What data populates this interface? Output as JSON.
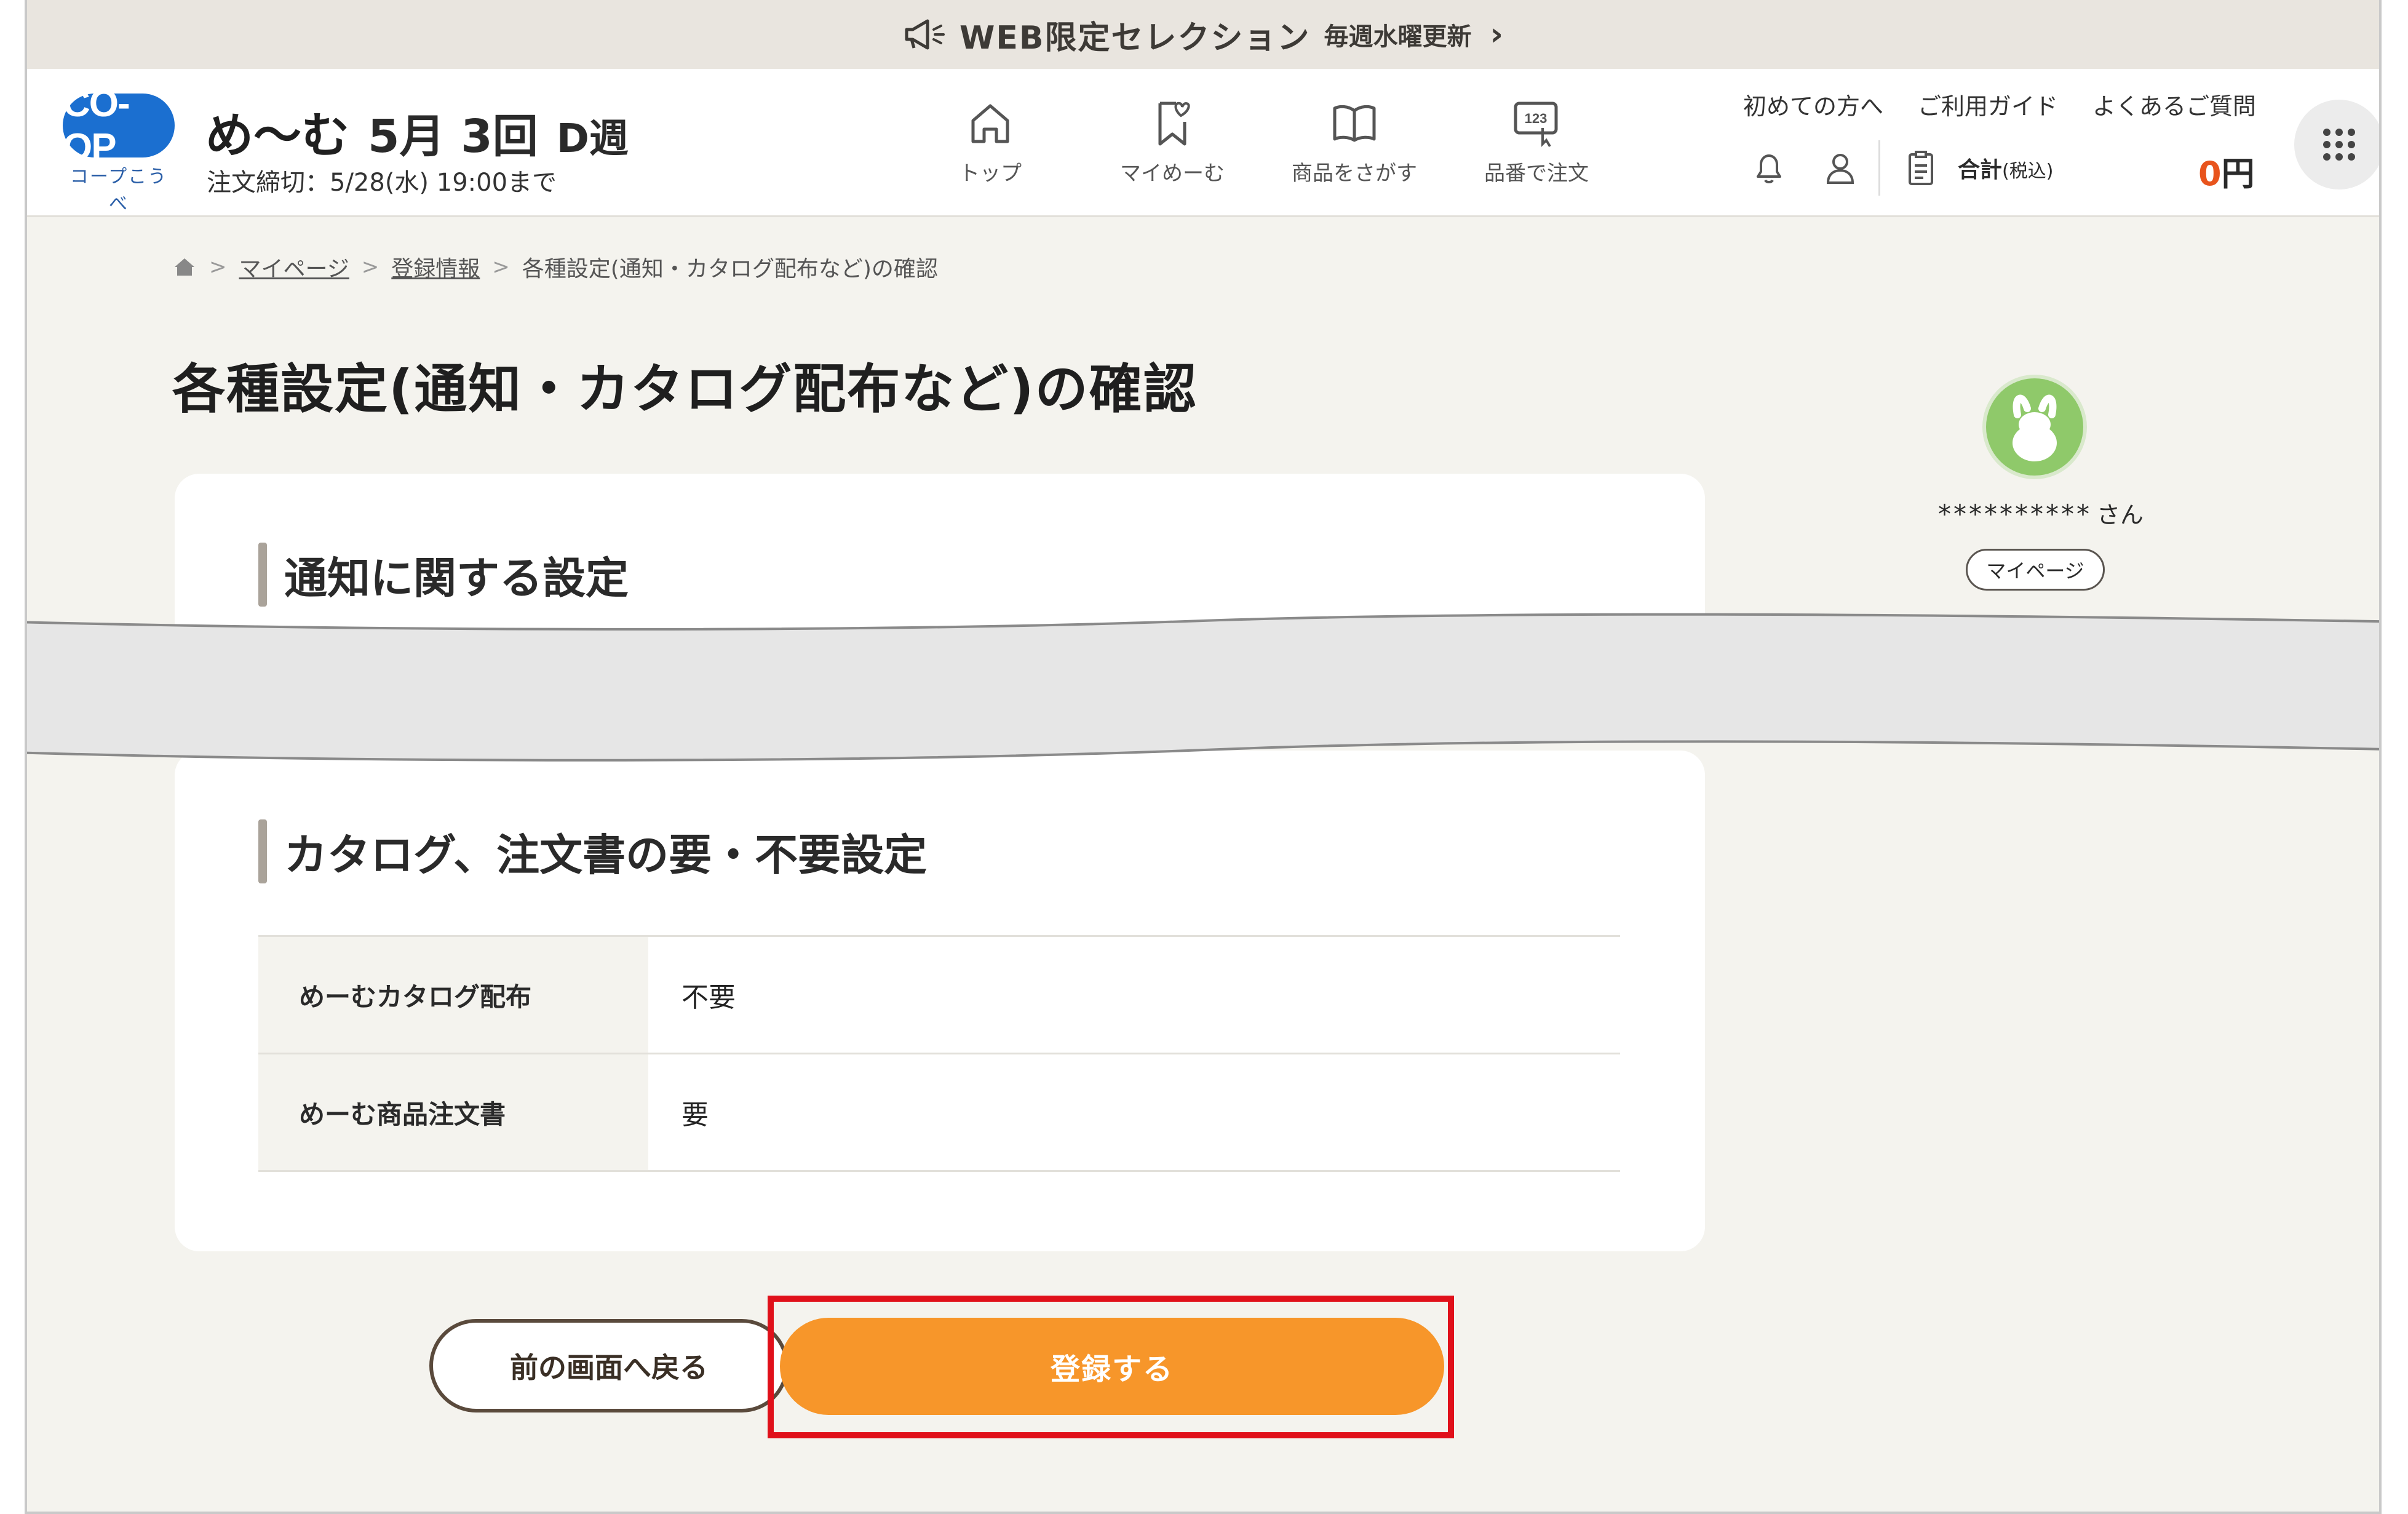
{
  "promo": {
    "title": "WEB限定セレクション",
    "subtitle": "毎週水曜更新",
    "chevron": "›",
    "icon": "megaphone-icon"
  },
  "header": {
    "logo_mark": "CO-OP",
    "logo_sub": "コープこうべ",
    "brand": "め〜む",
    "round": "5月 3回",
    "week": "D週",
    "deadline": "注文締切：5/28(水) 19:00まで",
    "nav": [
      {
        "label": "トップ",
        "icon": "home-icon"
      },
      {
        "label": "マイめーむ",
        "icon": "bookmark-heart-icon"
      },
      {
        "label": "商品をさがす",
        "icon": "book-icon"
      },
      {
        "label": "品番で注文",
        "icon": "number-keypad-icon"
      }
    ],
    "links": [
      "初めての方へ",
      "ご利用ガイド",
      "よくあるご質問"
    ],
    "total_label": "合計",
    "total_tax": "(税込)",
    "total_value": "0",
    "total_unit": "円"
  },
  "breadcrumb": {
    "items": [
      "マイページ",
      "登録情報"
    ],
    "current": "各種設定(通知・カタログ配布など)の確認",
    "separator": ">"
  },
  "page_title": "各種設定(通知・カタログ配布など)の確認",
  "notification_section": {
    "heading": "通知に関する設定"
  },
  "catalog_section": {
    "heading": "カタログ、注文書の要・不要設定",
    "rows": [
      {
        "label": "めーむカタログ配布",
        "value": "不要"
      },
      {
        "label": "めーむ商品注文書",
        "value": "要"
      }
    ]
  },
  "user": {
    "name": "**********",
    "honorific": "さん",
    "mypage_label": "マイページ"
  },
  "actions": {
    "back_label": "前の画面へ戻る",
    "register_label": "登録する"
  },
  "colors": {
    "accent": "#f7962a",
    "highlight": "#e0101a",
    "background": "#f4f3ee"
  }
}
